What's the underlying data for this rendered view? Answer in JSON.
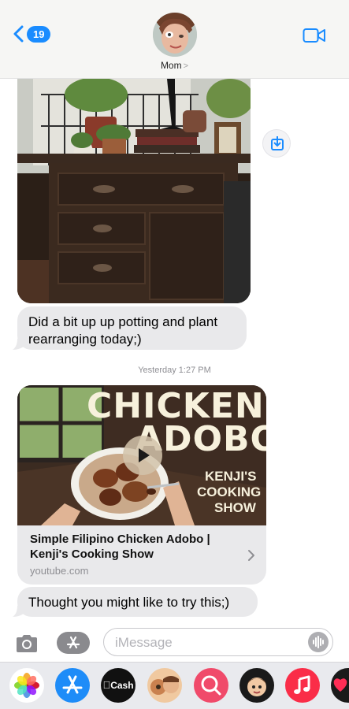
{
  "header": {
    "back_count": "19",
    "contact_name": "Mom",
    "name_chevron": ">"
  },
  "messages": {
    "text1": "Did a bit up up potting and plant rearranging today;)",
    "timestamp": "Yesterday 1:27 PM",
    "link": {
      "thumb_line1": "CHICKEN",
      "thumb_line2": "ADOBO",
      "thumb_show1": "KENJI'S",
      "thumb_show2": "COOKING",
      "thumb_show3": "SHOW",
      "title": "Simple Filipino Chicken Adobo | Kenji's Cooking Show",
      "domain": "youtube.com"
    },
    "text2": "Thought you might like to try this;)"
  },
  "composer": {
    "placeholder": "iMessage"
  },
  "drawer": {
    "cash_label": "Cash"
  },
  "colors": {
    "accent": "#1a8cff",
    "bubble_gray": "#e9e9eb"
  },
  "icons": [
    "chevron-left-icon",
    "video-camera-icon",
    "download-icon",
    "camera-icon",
    "app-store-icon",
    "audio-waveform-icon",
    "photos-icon",
    "apple-cash-icon",
    "memoji-icon",
    "image-search-icon",
    "music-icon",
    "heart-icon"
  ]
}
